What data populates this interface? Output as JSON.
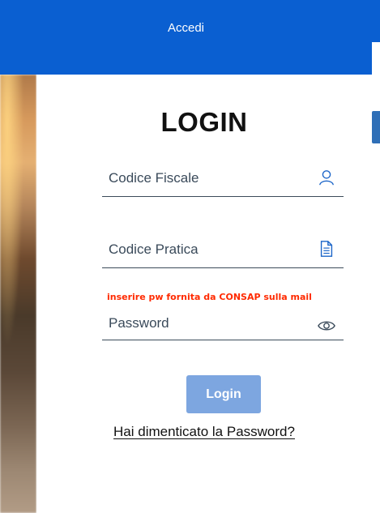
{
  "header": {
    "title": "Accedi"
  },
  "modal": {
    "heading": "LOGIN",
    "fields": {
      "codice_fiscale": {
        "placeholder": "Codice Fiscale",
        "icon": "user-icon"
      },
      "codice_pratica": {
        "placeholder": "Codice Pratica",
        "icon": "document-icon"
      },
      "password": {
        "placeholder": "Password",
        "icon": "eye-icon"
      }
    },
    "password_hint": "inserire pw fornita da CONSAP sulla mail",
    "login_button": "Login",
    "forgot_link": "Hai dimenticato la Password?"
  },
  "colors": {
    "header_bg": "#0a5fd1",
    "button_bg": "#7da6e0",
    "hint_text": "#ff2a00"
  }
}
